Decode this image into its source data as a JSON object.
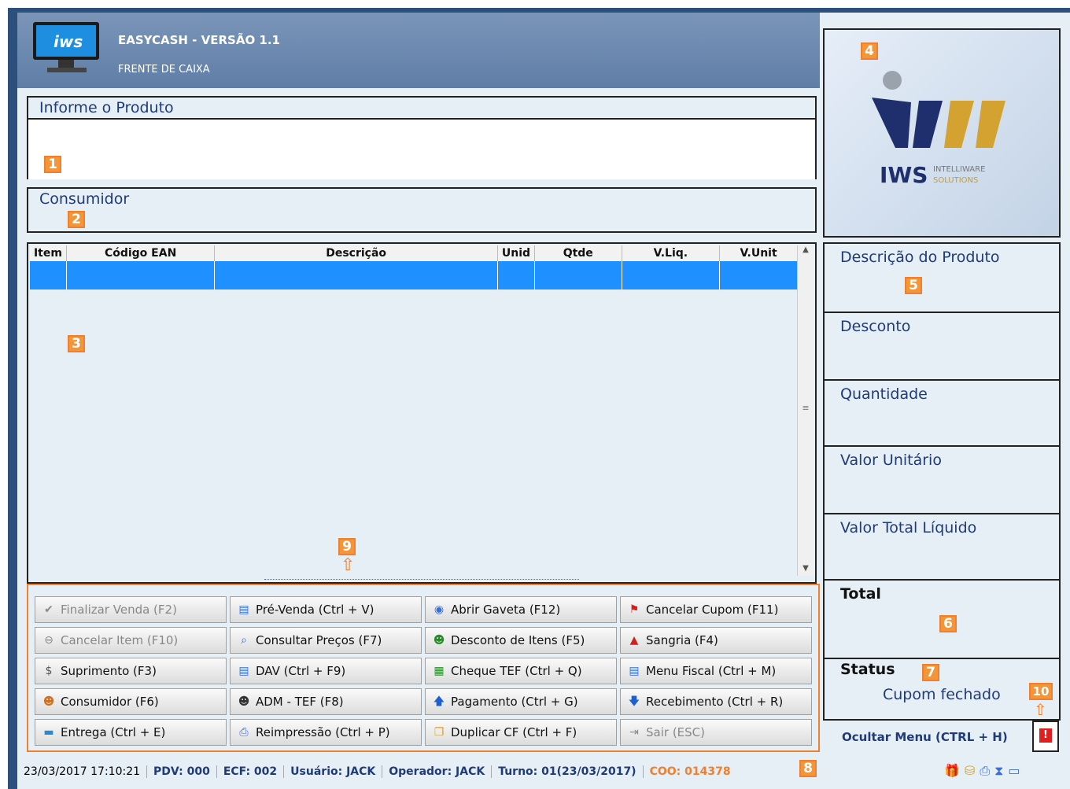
{
  "header": {
    "title": "EASYCASH - VERSÃO 1.1",
    "subtitle": "FRENTE DE CAIXA"
  },
  "logo": {
    "brand": "IWS",
    "tagline_1": "INTELLIWARE",
    "tagline_2": "SOLUTIONS"
  },
  "product_panel": {
    "label": "Informe o Produto",
    "value": ""
  },
  "consumer_panel": {
    "label": "Consumidor"
  },
  "table": {
    "columns": [
      "Item",
      "Código EAN",
      "Descrição",
      "Unid",
      "Qtde",
      "V.Liq.",
      "V.Unit"
    ]
  },
  "right": {
    "descricao": "Descrição do Produto",
    "desconto": "Desconto",
    "quantidade": "Quantidade",
    "valor_unitario": "Valor Unitário",
    "valor_total": "Valor Total Líquido",
    "total": "Total",
    "status_label": "Status",
    "status_value": "Cupom fechado",
    "hide_menu": "Ocultar Menu (CTRL + H)"
  },
  "buttons": [
    [
      "Finalizar Venda (F2)",
      "Pré-Venda (Ctrl + V)",
      "Abrir Gaveta (F12)",
      "Cancelar Cupom (F11)"
    ],
    [
      "Cancelar Item (F10)",
      "Consultar Preços (F7)",
      "Desconto de Itens (F5)",
      "Sangria (F4)"
    ],
    [
      "Suprimento (F3)",
      "DAV (Ctrl + F9)",
      "Cheque TEF (Ctrl + Q)",
      "Menu Fiscal (Ctrl + M)"
    ],
    [
      "Consumidor (F6)",
      "ADM - TEF (F8)",
      "Pagamento (Ctrl + G)",
      "Recebimento (Ctrl + R)"
    ],
    [
      "Entrega (Ctrl + E)",
      "Reimpressão (Ctrl + P)",
      "Duplicar CF (Ctrl + F)",
      "Sair (ESC)"
    ]
  ],
  "statusbar": {
    "datetime": "23/03/2017 17:10:21",
    "pdv": "PDV: 000",
    "ecf": "ECF: 002",
    "usuario": "Usuário: JACK",
    "operador": "Operador: JACK",
    "turno": "Turno: 01(23/03/2017)",
    "coo": "COO: 014378"
  },
  "badges": [
    "1",
    "2",
    "3",
    "4",
    "5",
    "6",
    "7",
    "8",
    "9",
    "10"
  ],
  "colors": {
    "accent": "#f3963a",
    "selection": "#1e90ff",
    "label": "#1f3b78"
  }
}
